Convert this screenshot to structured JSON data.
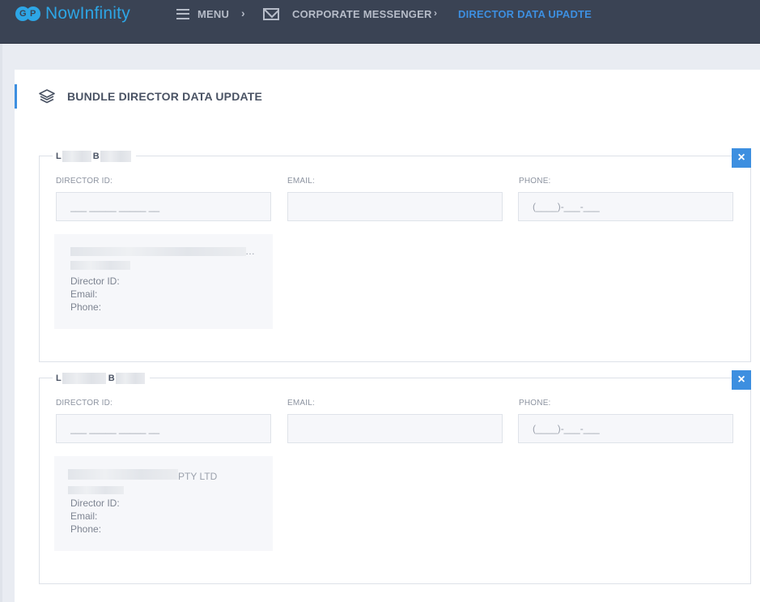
{
  "header": {
    "logo_text": "NowInfinity",
    "menu_label": "MENU",
    "breadcrumb_sep": "›",
    "crumb_messenger": "CORPORATE MESSENGER",
    "crumb_current": "DIRECTOR DATA UPADTE"
  },
  "card": {
    "title": "BUNDLE DIRECTOR DATA UPDATE"
  },
  "directors": [
    {
      "legend_first": "L",
      "legend_second": "B",
      "close_label": "×",
      "director_id_label": "DIRECTOR ID:",
      "director_id_placeholder": "___ _____ _____ __",
      "email_label": "EMAIL:",
      "email_value": "",
      "phone_label": "PHONE:",
      "phone_placeholder": "(____)-___-___",
      "company_suffix": "…",
      "director_id_text": "Director ID:",
      "email_text": "Email:",
      "phone_text": "Phone:"
    },
    {
      "legend_first": "L",
      "legend_second": "B",
      "close_label": "×",
      "director_id_label": "DIRECTOR ID:",
      "director_id_placeholder": "___ _____ _____ __",
      "email_label": "EMAIL:",
      "email_value": "",
      "phone_label": "PHONE:",
      "phone_placeholder": "(____)-___-___",
      "company_suffix": "PTY LTD",
      "director_id_text": "Director ID:",
      "email_text": "Email:",
      "phone_text": "Phone:"
    }
  ],
  "colors": {
    "navbar": "#3a4354",
    "accent": "#3d8fe0",
    "logo": "#2da6e6"
  }
}
